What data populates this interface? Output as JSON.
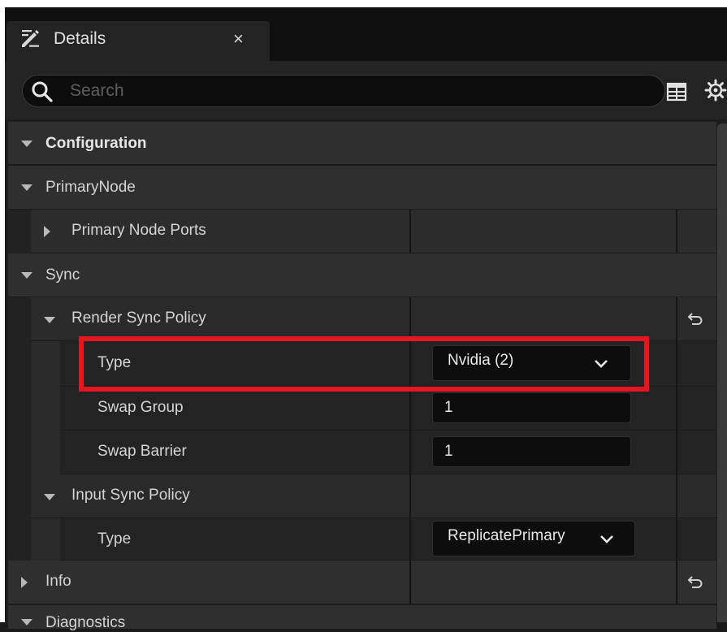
{
  "tab": {
    "title": "Details",
    "close": "×",
    "icon": "details-pencil-icon"
  },
  "search": {
    "placeholder": "Search"
  },
  "toolbar": {
    "grid_icon": "table-grid-icon",
    "settings_icon": "gear-icon"
  },
  "rows": {
    "configuration": "Configuration",
    "primary_node": "PrimaryNode",
    "primary_node_ports": "Primary Node Ports",
    "sync": "Sync",
    "render_sync_policy": "Render Sync Policy",
    "render_type_label": "Type",
    "render_type_value": "Nvidia (2)",
    "swap_group_label": "Swap Group",
    "swap_group_value": "1",
    "swap_barrier_label": "Swap Barrier",
    "swap_barrier_value": "1",
    "input_sync_policy": "Input Sync Policy",
    "input_type_label": "Type",
    "input_type_value": "ReplicatePrimary",
    "info": "Info",
    "diagnostics": "Diagnostics"
  },
  "colors": {
    "highlight": "#e5161f",
    "panel": "#232323",
    "category": "#2f2f2f"
  }
}
